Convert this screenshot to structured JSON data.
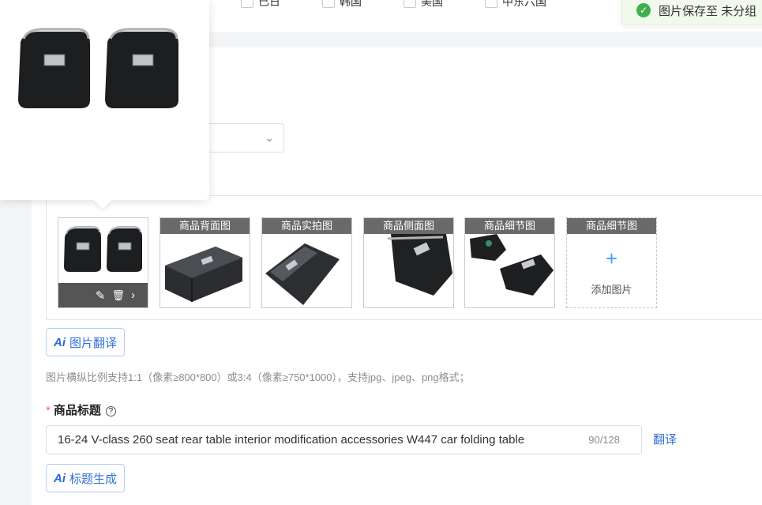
{
  "top_options": [
    "已日",
    "韩国",
    "美国",
    "中东六国"
  ],
  "toast": {
    "text": "图片保存至 未分组"
  },
  "gallery": {
    "thumbs": [
      {
        "label": ""
      },
      {
        "label": "商品背面图"
      },
      {
        "label": "商品实拍图"
      },
      {
        "label": "商品侧面图"
      },
      {
        "label": "商品细节图"
      },
      {
        "label": "商品细节图"
      }
    ],
    "add_label": "添加图片",
    "add_symbol": "+"
  },
  "buttons": {
    "image_translate": "图片翻译",
    "title_generate": "标题生成",
    "ai": "Ai"
  },
  "hint": "图片横纵比例支持1:1（像素≥800*800）或3:4（像素≥750*1000），支持jpg、jpeg、png格式；",
  "title_field": {
    "label": "商品标题",
    "required_mark": "*",
    "help_icon": "?",
    "value": "16-24 V-class 260 seat rear table interior modification accessories W447 car folding table",
    "count": "90/128",
    "translate_link": "翻译"
  },
  "icons": {
    "check": "✓",
    "edit": "✎",
    "delete": "🗑",
    "next": "›",
    "chevron": "⌄"
  }
}
